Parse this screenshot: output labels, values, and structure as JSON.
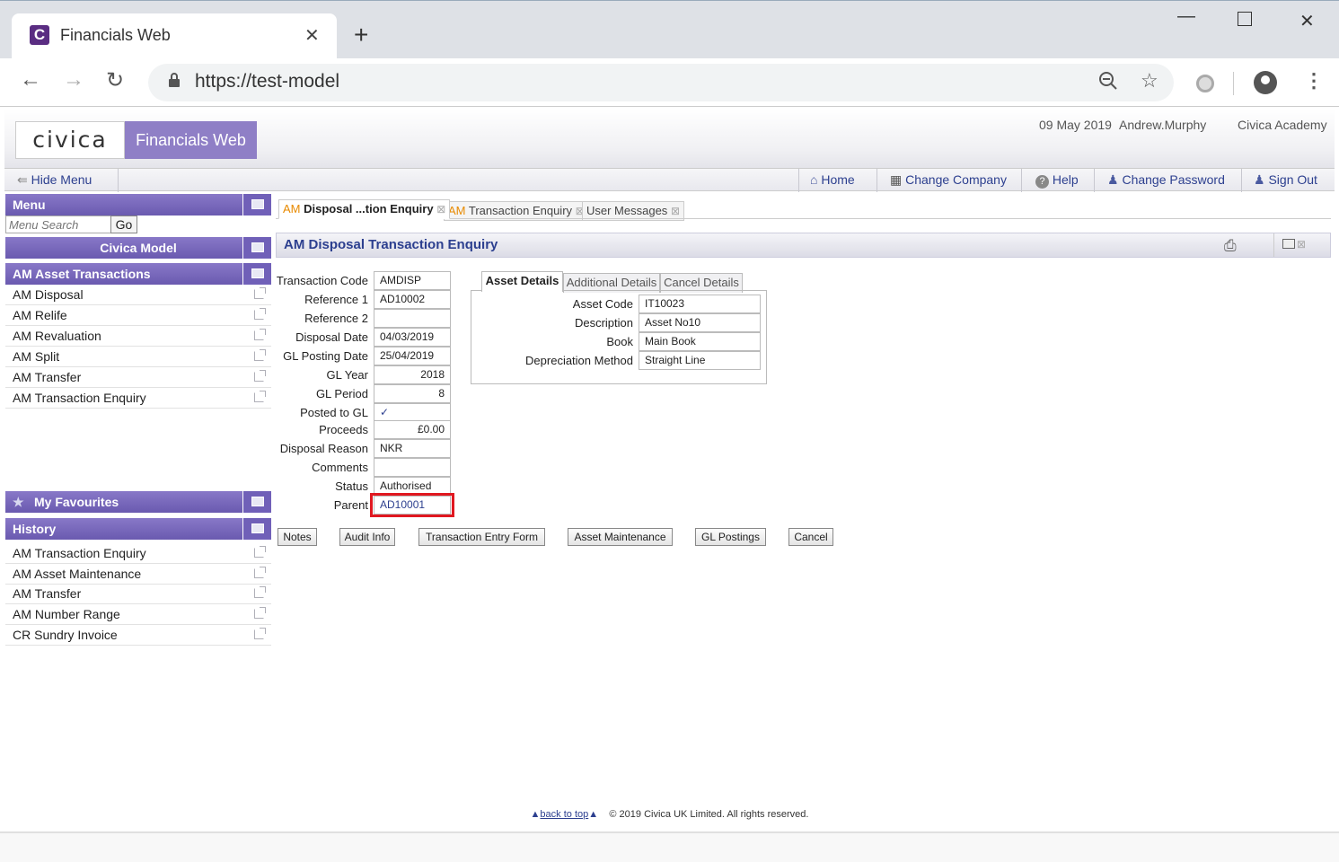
{
  "browser": {
    "tab_title": "Financials Web",
    "url": "https://test-model",
    "favicon_letter": "C"
  },
  "header": {
    "logo": "civica",
    "product": "Financials Web",
    "date": "09 May 2019",
    "user": "Andrew.Murphy",
    "company": "Civica Academy"
  },
  "navbar": {
    "hide_menu": "Hide Menu",
    "home": "Home",
    "change_company": "Change Company",
    "help": "Help",
    "change_password": "Change Password",
    "sign_out": "Sign Out"
  },
  "menu": {
    "title": "Menu",
    "search_placeholder": "Menu Search",
    "go": "Go",
    "model": "Civica Model",
    "section": "AM Asset Transactions",
    "items": [
      "AM Disposal",
      "AM Relife",
      "AM Revaluation",
      "AM Split",
      "AM Transfer",
      "AM Transaction Enquiry"
    ]
  },
  "favourites": {
    "title": "My Favourites"
  },
  "history": {
    "title": "History",
    "items": [
      "AM Transaction Enquiry",
      "AM Asset Maintenance",
      "AM Transfer",
      "AM Number Range",
      "CR Sundry Invoice"
    ]
  },
  "tabs": [
    {
      "prefix": "AM",
      "label": "Disposal ...tion Enquiry"
    },
    {
      "prefix": "AM",
      "label": "Transaction Enquiry"
    },
    {
      "prefix": "",
      "label": "User Messages"
    }
  ],
  "page_title": "AM Disposal Transaction Enquiry",
  "fields": [
    {
      "label": "Transaction Code",
      "value": "AMDISP"
    },
    {
      "label": "Reference 1",
      "value": "AD10002"
    },
    {
      "label": "Reference 2",
      "value": ""
    },
    {
      "label": "Disposal Date",
      "value": "04/03/2019"
    },
    {
      "label": "GL Posting Date",
      "value": "25/04/2019"
    },
    {
      "label": "GL Year",
      "value": "2018"
    },
    {
      "label": "GL Period",
      "value": "8"
    },
    {
      "label": "Posted to GL",
      "value": "✓"
    },
    {
      "label": "Proceeds",
      "value": "£0.00"
    },
    {
      "label": "Disposal Reason",
      "value": "NKR"
    },
    {
      "label": "Comments",
      "value": ""
    },
    {
      "label": "Status",
      "value": "Authorised"
    },
    {
      "label": "Parent",
      "value": "AD10001"
    }
  ],
  "detail_tabs": [
    "Asset Details",
    "Additional Details",
    "Cancel Details"
  ],
  "asset": [
    {
      "label": "Asset Code",
      "value": "IT10023"
    },
    {
      "label": "Description",
      "value": "Asset No10"
    },
    {
      "label": "Book",
      "value": "Main Book"
    },
    {
      "label": "Depreciation Method",
      "value": "Straight Line"
    }
  ],
  "buttons": [
    "Notes",
    "Audit Info",
    "Transaction Entry Form",
    "Asset Maintenance",
    "GL Postings",
    "Cancel"
  ],
  "footer": {
    "back_to_top": "back to top",
    "copyright": "© 2019 Civica UK Limited. All rights reserved."
  },
  "colors": {
    "accent": "#7060b8",
    "highlight": "#e01820",
    "link": "#2c3f8f"
  }
}
